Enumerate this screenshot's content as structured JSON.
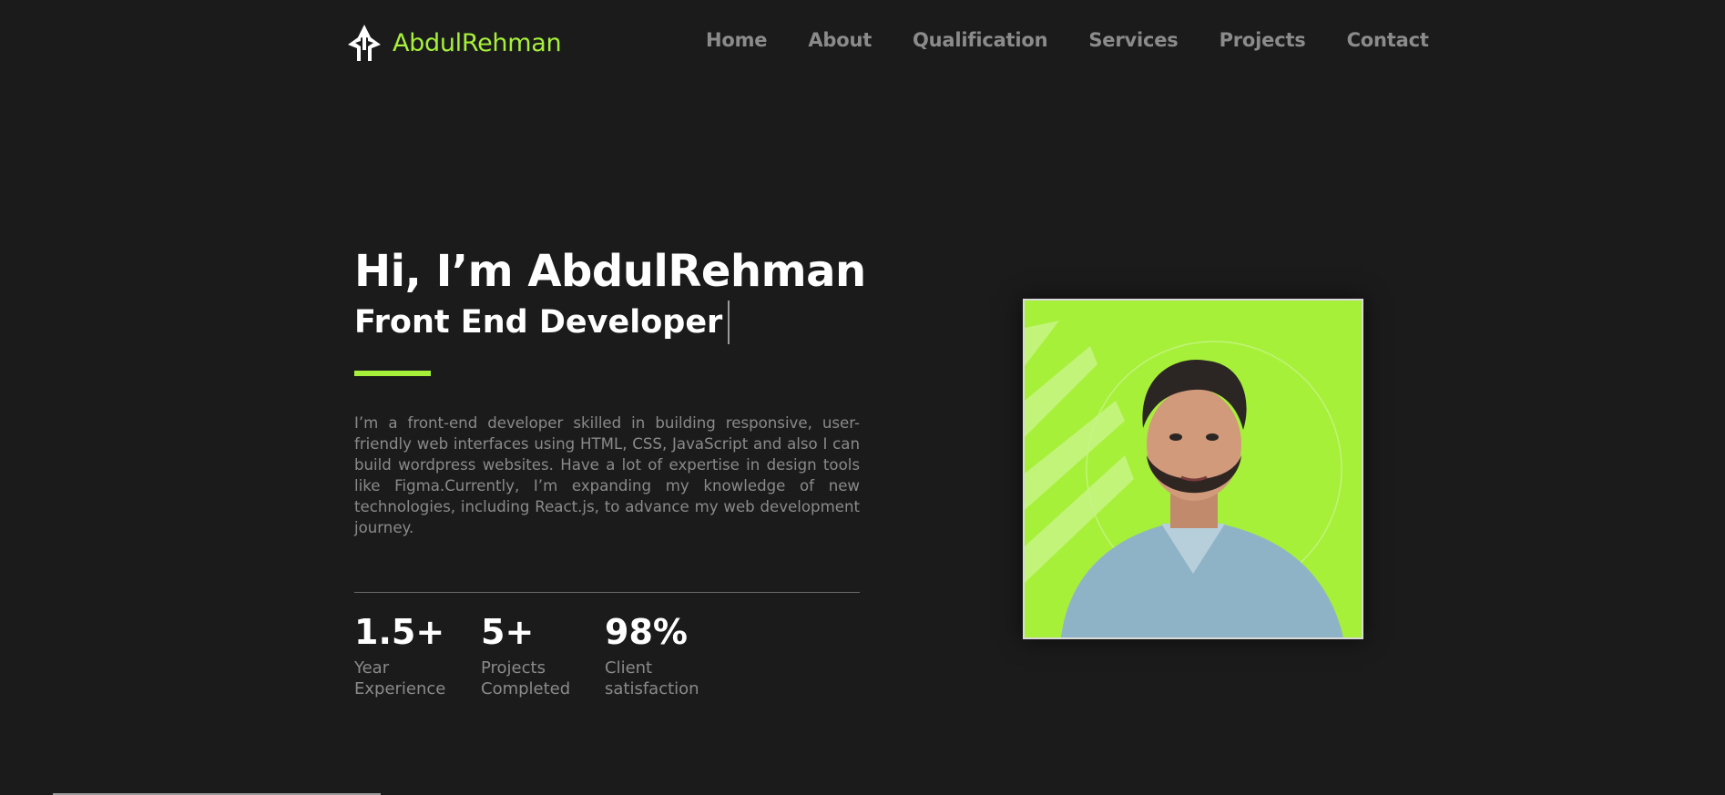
{
  "brand": {
    "name": "AbdulRehman",
    "accent_color": "#a6f03a",
    "logo_icon": "arrow-monogram-logo"
  },
  "nav": {
    "items": [
      {
        "label": "Home"
      },
      {
        "label": "About"
      },
      {
        "label": "Qualification"
      },
      {
        "label": "Services"
      },
      {
        "label": "Projects"
      },
      {
        "label": "Contact"
      }
    ]
  },
  "hero": {
    "title": "Hi, I’m AbdulRehman",
    "subtitle": "Front End Developer",
    "bio": "I’m a front-end developer skilled in building responsive, user-friendly web interfaces using HTML, CSS, JavaScript and also I can build wordpress websites. Have a lot of expertise in design tools like Figma.Currently, I’m expanding my knowledge of new technologies, including React.js, to advance my web development journey."
  },
  "stats": [
    {
      "value": "1.5+",
      "label": "Year Experience"
    },
    {
      "value": "5+",
      "label": "Projects Completed"
    },
    {
      "value": "98%",
      "label": "Client satisfaction"
    }
  ],
  "colors": {
    "background": "#1b1b1b",
    "nav_text": "#8b8b8b",
    "body_text": "#8a8a8a"
  }
}
